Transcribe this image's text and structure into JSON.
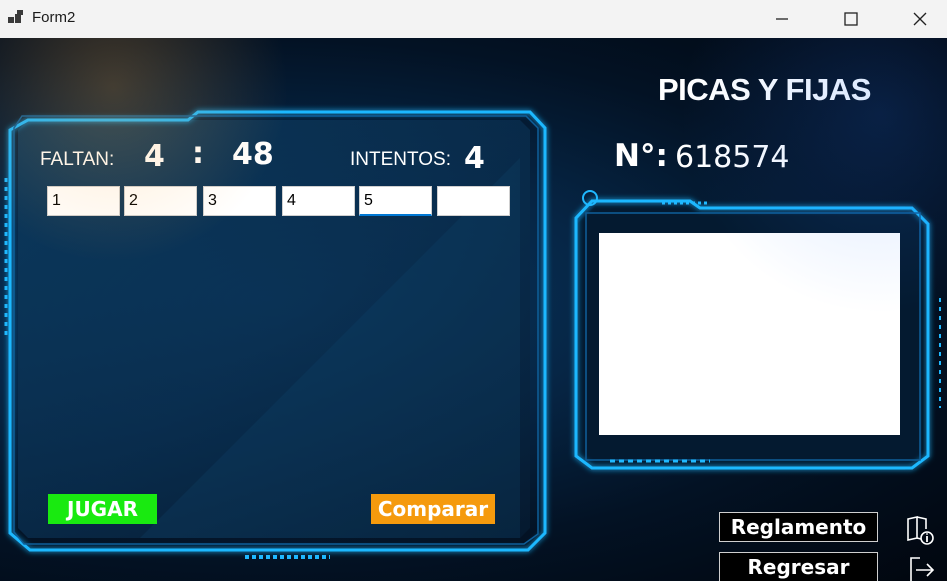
{
  "window": {
    "title": "Form2",
    "minimize_icon": "minimize-icon",
    "maximize_icon": "maximize-icon",
    "close_icon": "close-icon"
  },
  "game": {
    "heading": "PICAS Y FIJAS",
    "faltan_label": "FALTAN:",
    "minutes": "4",
    "separator": ":",
    "seconds": "48",
    "intentos_label": "INTENTOS:",
    "intentos_value": "4",
    "number_label": "N°:",
    "number_value": "618574",
    "inputs": [
      "1",
      "2",
      "3",
      "4",
      "5",
      ""
    ]
  },
  "buttons": {
    "jugar": "JUGAR",
    "comparar": "Comparar",
    "reglamento": "Reglamento",
    "regresar": "Regresar"
  },
  "colors": {
    "jugar_bg": "#19ea10",
    "comparar_bg": "#f59a0d",
    "frame_glow": "#1fb8ff",
    "background": "#031224"
  },
  "icons": {
    "reglamento": "book-info-icon",
    "regresar": "exit-arrow-icon"
  }
}
